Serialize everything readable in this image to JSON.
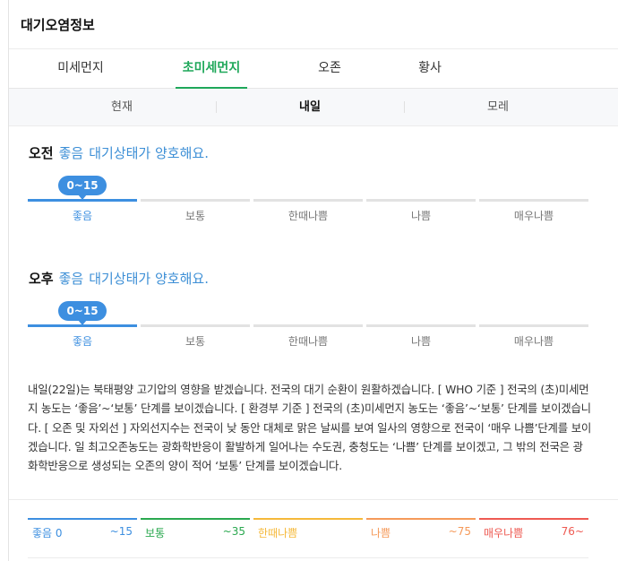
{
  "header": {
    "title": "대기오염정보"
  },
  "tabs": [
    {
      "label": "미세먼지",
      "active": false
    },
    {
      "label": "초미세먼지",
      "active": true
    },
    {
      "label": "오존",
      "active": false
    },
    {
      "label": "황사",
      "active": false
    }
  ],
  "subtabs": [
    {
      "label": "현재",
      "active": false
    },
    {
      "label": "내일",
      "active": true
    },
    {
      "label": "모레",
      "active": false
    }
  ],
  "accent_color": "#1fa85a",
  "level_labels": [
    "좋음",
    "보통",
    "한때나쁨",
    "나쁨",
    "매우나쁨"
  ],
  "forecast": {
    "am": {
      "period": "오전",
      "grade": "좋음",
      "desc": "대기상태가 양호해요.",
      "range": "0~15",
      "active_level": 0
    },
    "pm": {
      "period": "오후",
      "grade": "좋음",
      "desc": "대기상태가 양호해요.",
      "range": "0~15",
      "active_level": 0
    }
  },
  "summary": "내일(22일)는 북태평양 고기압의 영향을 받겠습니다. 전국의 대기 순환이 원활하겠습니다. [ WHO 기준 ] 전국의 (초)미세먼지 농도는 ‘좋음’~‘보통’ 단계를 보이겠습니다. [ 환경부 기준 ] 전국의 (초)미세먼지 농도는 ‘좋음’~‘보통’ 단계를 보이겠습니다. [ 오존 및 자외선 ] 자외선지수는 전국이 낮 동안 대체로 맑은 날씨를 보여 일사의 영향으로 전국이 ‘매우 나쁨’단계를 보이겠습니다. 일 최고오존농도는 광화학반응이 활발하게 일어나는 수도권, 충청도는 ‘나쁨’ 단계를 보이겠고, 그 밖의 전국은 광화학반응으로 생성되는 오존의 양이 적어 ‘보통’ 단계를 보이겠습니다.",
  "legend": [
    {
      "name": "좋음 0",
      "range": "~15",
      "color": "#3d8fe0"
    },
    {
      "name": "보통",
      "range": "~35",
      "color": "#2aa84f"
    },
    {
      "name": "한때나쁨",
      "range": "",
      "color": "#f5b93a"
    },
    {
      "name": "나쁨",
      "range": "~75",
      "color": "#f59a5a"
    },
    {
      "name": "매우나쁨",
      "range": "76~",
      "color": "#ee5a52"
    }
  ]
}
